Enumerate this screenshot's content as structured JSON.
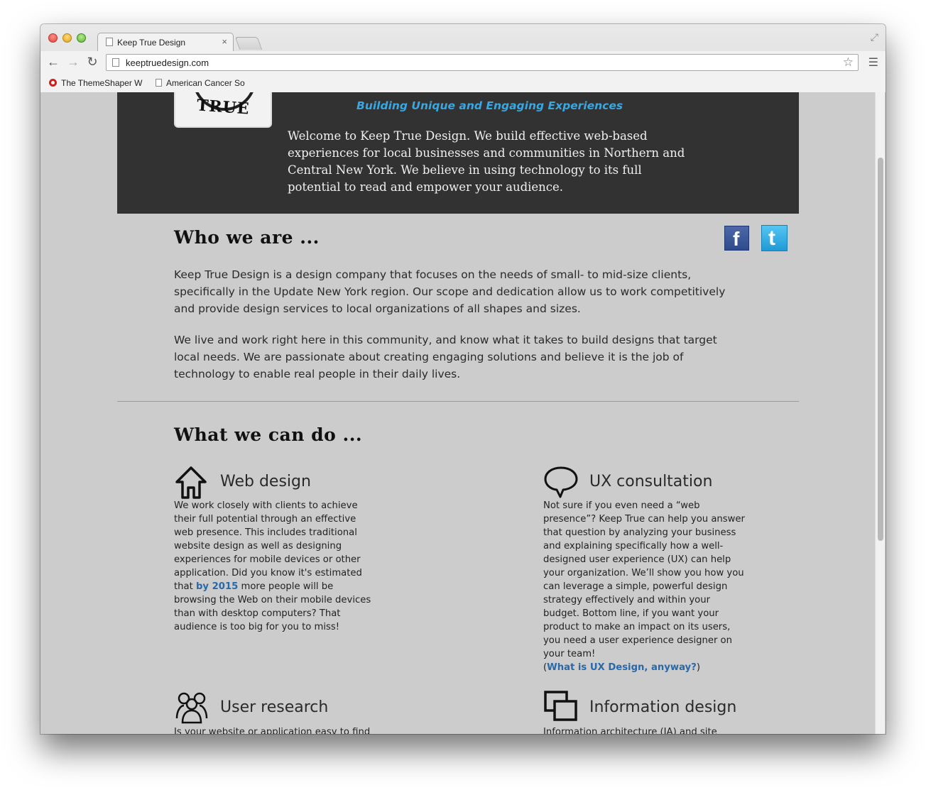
{
  "browser": {
    "tab_title": "Keep True Design",
    "tab_close": "×",
    "url": "keeptruedesign.com",
    "bookmarks": [
      {
        "label": "The ThemeShaper W"
      },
      {
        "label": "American Cancer So"
      }
    ]
  },
  "hero": {
    "logo_text": "TRUE",
    "tagline": "Building Unique and Engaging Experiences",
    "welcome": "Welcome to Keep True Design. We build effective web-based experiences for local businesses and communities in Northern and Central New York. We believe in using technology to its full potential to read and empower your audience."
  },
  "social": {
    "facebook_glyph": "f",
    "twitter_glyph": "t"
  },
  "who": {
    "heading": "Who we are ...",
    "para1": "Keep True Design is a design company that focuses on the needs of small- to mid-size clients, specifically in the Update New York region. Our scope and dedication allow us to work competitively and provide design services to local organizations of all shapes and sizes.",
    "para2": "We live and work right here in this community, and know what it takes to build designs that target local needs. We are passionate about creating engaging solutions and believe it is the job of technology to enable real people in their daily lives."
  },
  "what": {
    "heading": "What we can do ...",
    "services": [
      {
        "title": "Web design",
        "icon": "house-icon",
        "body_before": "We work closely with clients to achieve their full potential through an effective web presence. This includes traditional website design as well as designing experiences for mobile devices or other application. Did you know it's estimated that ",
        "link": "by 2015",
        "body_after": " more people will be browsing the Web on their mobile devices than with desktop computers? That audience is too big for you to miss!"
      },
      {
        "title": "UX consultation",
        "icon": "speech-bubble-icon",
        "body": "Not sure if you even need a “web presence”? Keep True can help you answer that question by analyzing your business and explaining specifically how a well-designed user experience (UX) can help your organization. We’ll show you how you can leverage a simple, powerful design strategy effectively and within your budget. Bottom line, if you want your product to make an impact on its users, you need a user experience designer on your team!",
        "link_open": "(",
        "link": "What is UX Design, anyway?",
        "link_close": ")"
      },
      {
        "title": "User research",
        "icon": "users-icon",
        "body": "Is your website or application easy to find"
      },
      {
        "title": "Information design",
        "icon": "windows-icon",
        "body": "Information architecture (IA) and site"
      }
    ]
  },
  "colors": {
    "page_bg": "#cccccc",
    "hero_bg": "#323232",
    "tagline": "#38a7e2",
    "link": "#2a68a8"
  }
}
